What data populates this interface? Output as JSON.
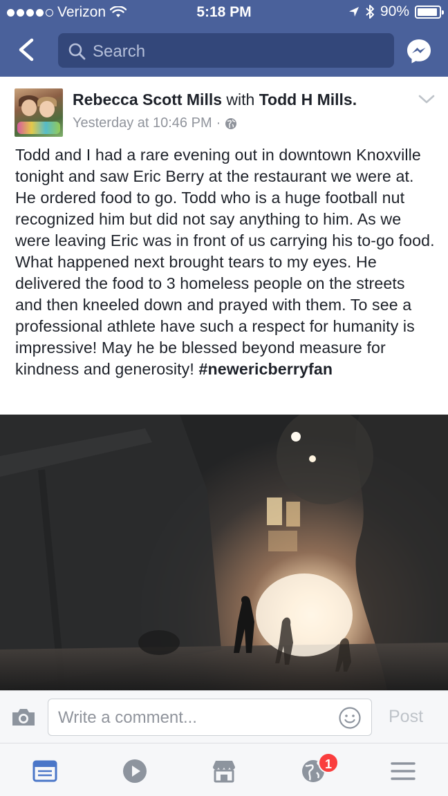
{
  "status_bar": {
    "carrier": "Verizon",
    "time": "5:18 PM",
    "battery": "90%",
    "signal_dots_filled": 4,
    "signal_dots_total": 5
  },
  "nav": {
    "search_placeholder": "Search"
  },
  "post": {
    "author": "Rebecca Scott Mills",
    "with_word": "with",
    "tagged": "Todd H Mills.",
    "timestamp": "Yesterday at 10:46 PM",
    "separator": "·",
    "privacy_icon": "globe-icon",
    "body": "Todd and I had a rare evening out in downtown Knoxville tonight and saw Eric Berry at the restaurant we were at. He ordered food to go. Todd who is a huge football nut recognized him but did not say anything to him. As we were leaving Eric was in front of us carrying his to-go food. What happened next brought tears to my eyes. He delivered the food to 3 homeless people on the streets and then kneeled down and prayed with them. To see a professional athlete have such a respect for humanity is impressive! May he be blessed beyond measure for kindness and generosity!",
    "hashtag": "#newericberryfan"
  },
  "comment_bar": {
    "placeholder": "Write a comment...",
    "post_label": "Post"
  },
  "tabbar": {
    "tabs": [
      "news-feed",
      "video",
      "marketplace",
      "notifications",
      "more"
    ],
    "notifications_badge": "1"
  },
  "colors": {
    "header_bg": "#4a619b",
    "search_bg": "#33477a",
    "active_tab": "#4a76c8",
    "inactive_tab": "#8d949e",
    "badge": "#fa3e3e"
  }
}
